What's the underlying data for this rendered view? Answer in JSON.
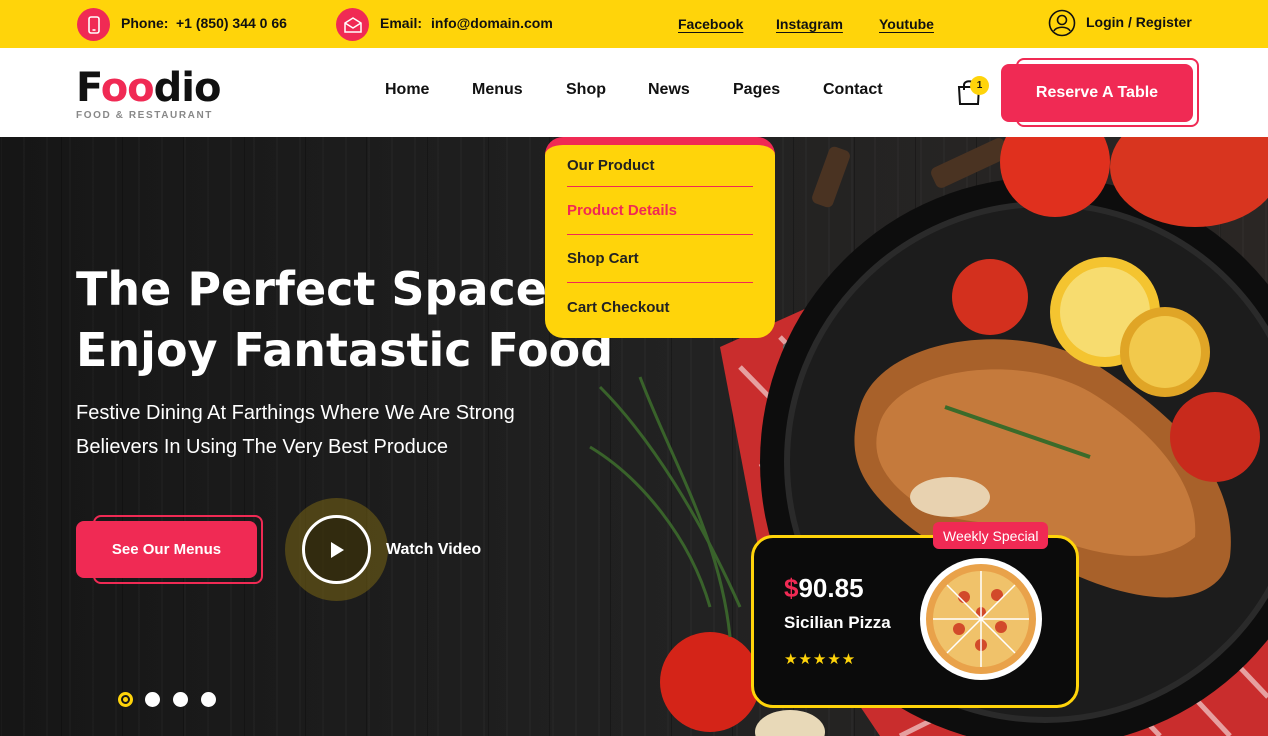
{
  "topbar": {
    "phone_label": "Phone:",
    "phone_value": "+1 (850) 344 0 66",
    "email_label": "Email:",
    "email_value": "info@domain.com",
    "social": [
      "Facebook",
      "Instagram",
      "Youtube"
    ],
    "login": "Login / Register"
  },
  "header": {
    "logo_f": "F",
    "logo_oo": "oo",
    "logo_rest": "dio",
    "logo_sub": "FOOD & RESTAURANT",
    "nav": [
      "Home",
      "Menus",
      "Shop",
      "News",
      "Pages",
      "Contact"
    ],
    "cart_count": "1",
    "reserve": "Reserve A Table"
  },
  "dropdown": {
    "items": [
      "Our Product",
      "Product Details",
      "Shop Cart",
      "Cart Checkout"
    ],
    "active_index": 1
  },
  "hero": {
    "title_line1": "The Perfect Space To",
    "title_line2": "Enjoy Fantastic Food",
    "subtitle_line1": "Festive Dining At Farthings Where We Are Strong",
    "subtitle_line2": "Believers In Using The Very Best Produce",
    "cta": "See Our Menus",
    "video": "Watch Video",
    "slides": 4,
    "active_slide": 0
  },
  "special": {
    "tag": "Weekly Special",
    "currency": "$",
    "price": "90.85",
    "name": "Sicilian Pizza",
    "rating": 5,
    "stars": "★★★★★"
  },
  "colors": {
    "yellow": "#ffd40a",
    "red": "#f02a54",
    "dark": "#111111"
  },
  "icons": [
    "phone-icon",
    "mail-icon",
    "user-icon",
    "shopping-bag-icon",
    "play-icon",
    "star-icon"
  ]
}
